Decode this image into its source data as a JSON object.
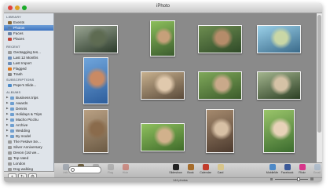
{
  "window": {
    "title": "iPhoto"
  },
  "sidebar": {
    "sections": [
      {
        "label": "LIBRARY",
        "items": [
          {
            "label": "Events",
            "icon": "events-icon",
            "color": "#8b6a3a"
          },
          {
            "label": "Photos",
            "icon": "photos-icon",
            "color": "#5a7fb0",
            "selected": true
          },
          {
            "label": "Faces",
            "icon": "faces-icon",
            "color": "#6d86a8"
          },
          {
            "label": "Places",
            "icon": "places-icon",
            "color": "#c0463a"
          }
        ]
      },
      {
        "label": "RECENT",
        "items": [
          {
            "label": "Geotagging tes...",
            "icon": "album-icon",
            "color": "#9a9a9a"
          },
          {
            "label": "Last 12 Months",
            "icon": "calendar-icon",
            "color": "#6f8fb8"
          },
          {
            "label": "Last Import",
            "icon": "import-icon",
            "color": "#6f8fb8"
          },
          {
            "label": "Flagged",
            "icon": "flag-icon",
            "color": "#e07a1f"
          },
          {
            "label": "Trash",
            "icon": "trash-icon",
            "color": "#8a8a8a"
          }
        ]
      },
      {
        "label": "SUBSCRIPTIONS",
        "items": [
          {
            "label": "Pepe's Slide...",
            "icon": "subscription-icon",
            "color": "#4f8cc9"
          }
        ]
      },
      {
        "label": "ALBUMS",
        "items": [
          {
            "label": "Business trips",
            "icon": "folder-icon",
            "color": "#6f9fd0"
          },
          {
            "label": "Awards",
            "icon": "folder-icon",
            "color": "#6f9fd0"
          },
          {
            "label": "Dennis",
            "icon": "folder-icon",
            "color": "#6f9fd0"
          },
          {
            "label": "Holidays & Trips",
            "icon": "folder-icon",
            "color": "#6f9fd0"
          },
          {
            "label": "Macho Picchu",
            "icon": "folder-icon",
            "color": "#6f9fd0"
          },
          {
            "label": "Archive",
            "icon": "folder-icon",
            "color": "#6f9fd0"
          },
          {
            "label": "Wedding",
            "icon": "folder-icon",
            "color": "#6f9fd0"
          },
          {
            "label": "By model",
            "icon": "folder-icon",
            "color": "#6f9fd0"
          },
          {
            "label": "The Festive Se...",
            "icon": "album-icon",
            "color": "#9a9a9a"
          },
          {
            "label": "Silver Anniversary",
            "icon": "album-icon",
            "color": "#9a9a9a"
          },
          {
            "label": "Devon (1st we...",
            "icon": "album-icon",
            "color": "#9a9a9a"
          },
          {
            "label": "Top rated",
            "icon": "smart-album-icon",
            "color": "#9a9a9a"
          },
          {
            "label": "London",
            "icon": "album-icon",
            "color": "#9a9a9a"
          },
          {
            "label": "Dog walking",
            "icon": "album-icon",
            "color": "#9a9a9a"
          }
        ]
      }
    ]
  },
  "photos": [
    {
      "c1": "#2b3a2a",
      "c2": "#9aa593",
      "c3": "#5e6b52"
    },
    {
      "c1": "#3b5c2e",
      "c2": "#8cbf5b",
      "c3": "#c6a07a"
    },
    {
      "c1": "#2f4a28",
      "c2": "#6d8d50",
      "c3": "#b58c6a"
    },
    {
      "c1": "#3a6a8a",
      "c2": "#9ad0e8",
      "c3": "#c9d7a6"
    },
    {
      "c1": "#2e5e9c",
      "c2": "#6fa5dc",
      "c3": "#c98a64"
    },
    {
      "c1": "#5a4a3a",
      "c2": "#c7b08e",
      "c3": "#e0c9ad"
    },
    {
      "c1": "#3c5b2b",
      "c2": "#7fa85a",
      "c3": "#c9a98a"
    },
    {
      "c1": "#2c3f24",
      "c2": "#a3b58e",
      "c3": "#d5c2a6"
    },
    {
      "c1": "#6b5a44",
      "c2": "#b9a083",
      "c3": "#8a6b4c"
    },
    {
      "c1": "#3f6b2a",
      "c2": "#8fc05e",
      "c3": "#d1b18c"
    },
    {
      "c1": "#4c3a2e",
      "c2": "#a58a6e",
      "c3": "#d7c0a5"
    },
    {
      "c1": "#3b6b2e",
      "c2": "#9ac56a",
      "c3": "#e7d2b8"
    }
  ],
  "toolbar": {
    "left": [
      {
        "label": "Info",
        "icon": "info-icon",
        "color": "#6c7a8c",
        "dim": true
      },
      {
        "label": "Edit",
        "icon": "edit-icon",
        "color": "#6d5f3f"
      },
      {
        "label": "Rotate",
        "icon": "rotate-icon",
        "color": "#7a7a7a",
        "dim": true
      },
      {
        "label": "Flag",
        "icon": "flag-icon",
        "color": "#8a8a8a",
        "dim": true
      },
      {
        "label": "Hide",
        "icon": "hide-icon",
        "color": "#c23b2b",
        "dim": true
      }
    ],
    "center": [
      {
        "label": "Slideshow",
        "icon": "slideshow-icon",
        "color": "#222222"
      },
      {
        "label": "Book",
        "icon": "book-icon",
        "color": "#a66c2a"
      },
      {
        "label": "Calendar",
        "icon": "calendar-icon",
        "color": "#c23b2b"
      },
      {
        "label": "Card",
        "icon": "card-icon",
        "color": "#d8c58a"
      }
    ],
    "right": [
      {
        "label": "MobileMe",
        "icon": "mobileme-icon",
        "color": "#4d89c7"
      },
      {
        "label": "Facebook",
        "icon": "facebook-icon",
        "color": "#3b5998"
      },
      {
        "label": "Flickr",
        "icon": "flickr-icon",
        "color": "#d7358a"
      },
      {
        "label": "Email",
        "icon": "email-icon",
        "color": "#8aa6c6",
        "dim": true
      }
    ]
  },
  "search": {
    "placeholder": ""
  },
  "status": {
    "count": "144 photos"
  },
  "bottom_buttons": [
    {
      "label": "+",
      "name": "add-button"
    },
    {
      "label": "↻",
      "name": "rotate-button"
    },
    {
      "label": "⚙",
      "name": "action-button"
    }
  ]
}
